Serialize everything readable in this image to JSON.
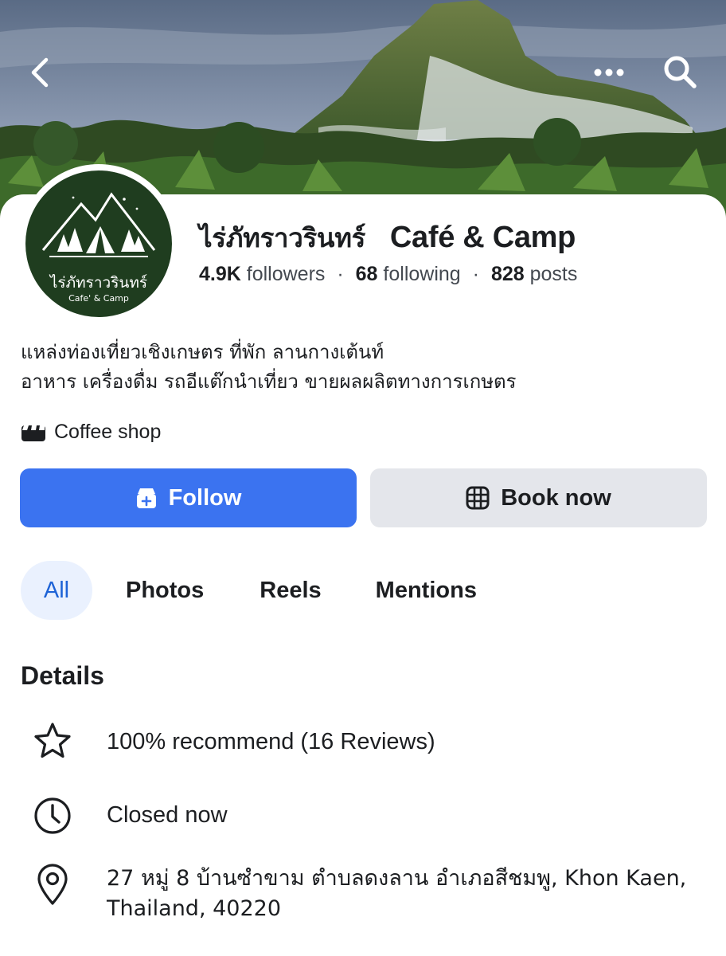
{
  "page": {
    "name_thai": "ไร่ภัทราวรินทร์",
    "name_latin": "Café & Camp",
    "followers_count": "4.9K",
    "followers_label": "followers",
    "following_count": "68",
    "following_label": "following",
    "posts_count": "828",
    "posts_label": "posts",
    "separator": "·",
    "bio_line1": "แหล่งท่องเที่ยวเชิงเกษตร ที่พัก ลานกางเต้นท์",
    "bio_line2": "อาหาร เครื่องดื่ม รถอีแต๊กนำเที่ยว ขายผลผลิตทางการเกษตร",
    "category": "Coffee shop",
    "category_icon": "storefront-icon"
  },
  "avatar": {
    "logo_text": "ไร่ภัทราวรินทร์",
    "logo_subtext": "Cafe' & Camp"
  },
  "header": {
    "back_icon": "chevron-left-icon",
    "more_icon": "more-dots-icon",
    "search_icon": "search-icon"
  },
  "actions": {
    "follow_label": "Follow",
    "follow_icon": "follow-page-icon",
    "book_label": "Book now",
    "book_icon": "calendar-grid-icon"
  },
  "tabs": [
    {
      "label": "All",
      "active": true
    },
    {
      "label": "Photos",
      "active": false
    },
    {
      "label": "Reels",
      "active": false
    },
    {
      "label": "Mentions",
      "active": false
    }
  ],
  "details": {
    "title": "Details",
    "recommend": "100% recommend (16 Reviews)",
    "recommend_icon": "star-icon",
    "hours": "Closed now",
    "hours_icon": "clock-icon",
    "address": "27 หมู่ 8 บ้านซำขาม ตำบลดงลาน อำเภอสีชมพู, Khon Kaen, Thailand, 40220",
    "address_icon": "location-pin-icon"
  },
  "colors": {
    "primary_blue": "#3b73f0",
    "tab_active_bg": "#eaf1fe",
    "tab_active_text": "#1e63d6",
    "secondary_button_bg": "#e4e6eb",
    "logo_green": "#1f3d1f"
  }
}
